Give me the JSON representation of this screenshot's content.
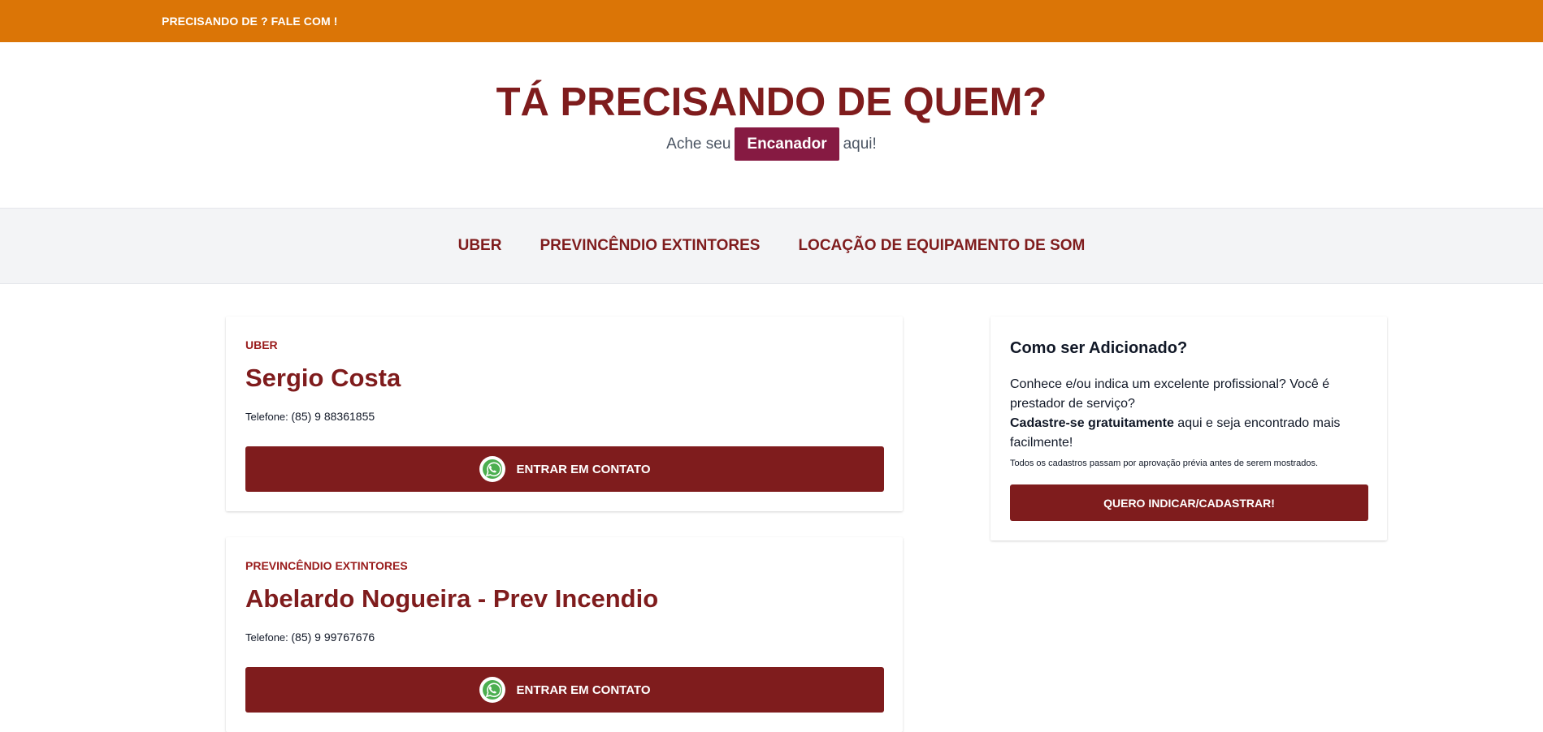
{
  "topbar": {
    "text": "PRECISANDO DE ? FALE COM !"
  },
  "hero": {
    "title": "TÁ PRECISANDO DE QUEM?",
    "prefix": "Ache seu",
    "badge": "Encanador",
    "suffix": "aqui!"
  },
  "nav": {
    "items": [
      {
        "label": "UBER"
      },
      {
        "label": "PREVINCÊNDIO EXTINTORES"
      },
      {
        "label": "LOCAÇÃO DE EQUIPAMENTO DE SOM"
      }
    ]
  },
  "listings": [
    {
      "category": "UBER",
      "name": "Sergio Costa",
      "phone_label": "Telefone:",
      "phone": "(85) 9 88361855",
      "button": "ENTRAR EM CONTATO",
      "icon": "whatsapp-icon"
    },
    {
      "category": "PREVINCÊNDIO EXTINTORES",
      "name": "Abelardo Nogueira - Prev Incendio",
      "phone_label": "Telefone:",
      "phone": "(85) 9 99767676",
      "button": "ENTRAR EM CONTATO",
      "icon": "whatsapp-icon"
    }
  ],
  "sidebar": {
    "title": "Como ser Adicionado?",
    "text_1": "Conhece e/ou indica um excelente profissional? Você é prestador de serviço?",
    "text_bold": "Cadastre-se gratuitamente",
    "text_2": "aqui e seja encontrado mais facilmente!",
    "note": "Todos os cadastros passam por aprovação prévia antes de serem mostrados.",
    "button": "QUERO INDICAR/CADASTRAR!"
  },
  "colors": {
    "topbar": "#db7506",
    "primary": "#7f1c1d",
    "badge": "#861a42",
    "whatsapp": "#4caf50"
  }
}
